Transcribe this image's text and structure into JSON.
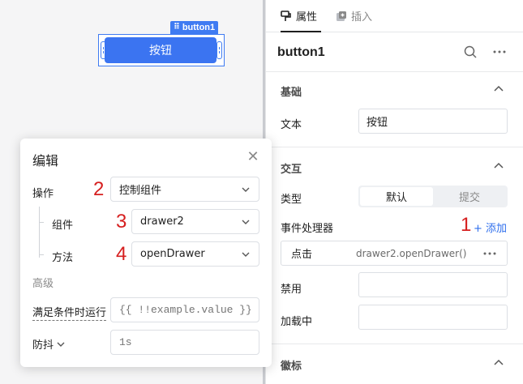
{
  "canvas": {
    "selection_tag": "button1",
    "button_label": "按钮"
  },
  "popover": {
    "title": "编辑",
    "action": {
      "label": "操作",
      "value": "控制组件",
      "marker": "2"
    },
    "component": {
      "label": "组件",
      "value": "drawer2",
      "marker": "3"
    },
    "method": {
      "label": "方法",
      "value": "openDrawer",
      "marker": "4"
    },
    "advanced_title": "高级",
    "condition": {
      "label": "满足条件时运行",
      "placeholder": "{{ !!example.value }}"
    },
    "debounce": {
      "label": "防抖",
      "placeholder": "1s"
    }
  },
  "panel": {
    "tabs": [
      {
        "label": "属性",
        "icon": "brush-icon",
        "active": true
      },
      {
        "label": "插入",
        "icon": "plus-square-icon",
        "active": false
      }
    ],
    "component_name": "button1",
    "basic": {
      "title": "基础",
      "text_label": "文本",
      "text_value": "按钮"
    },
    "interaction": {
      "title": "交互",
      "type_label": "类型",
      "type_options": [
        "默认",
        "提交"
      ],
      "type_selected": "默认",
      "event_handlers_label": "事件处理器",
      "add_marker": "1",
      "add_label": "+ 添加",
      "event": {
        "trigger": "点击",
        "action": "drawer2.openDrawer()"
      },
      "disabled_label": "禁用",
      "loading_label": "加载中"
    },
    "badge": {
      "title": "徽标"
    }
  },
  "colors": {
    "accent": "#3b74f1",
    "link": "#2f6fed",
    "marker": "#d61f1f"
  }
}
